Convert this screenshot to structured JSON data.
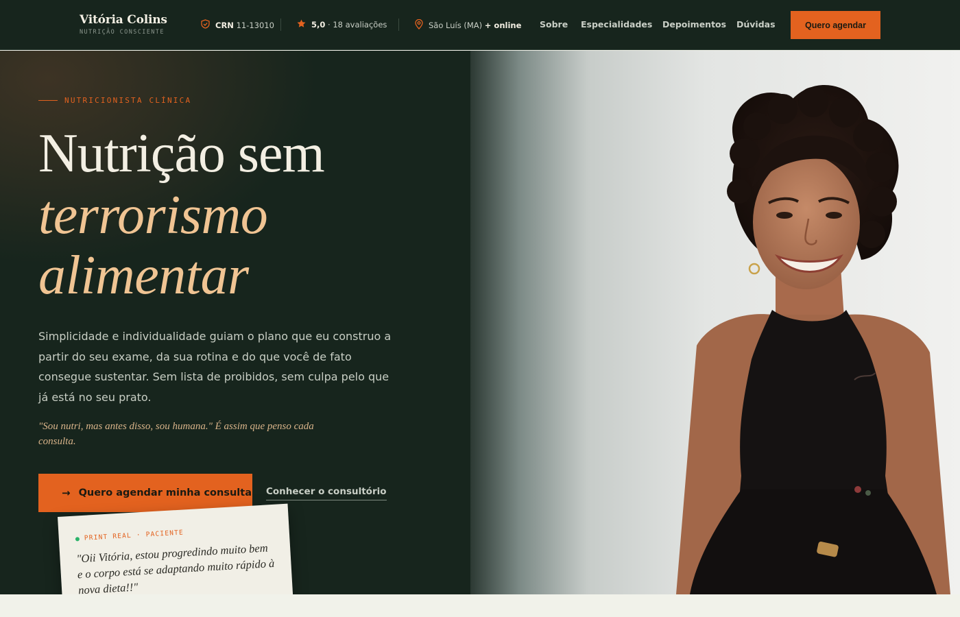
{
  "header": {
    "brand_name": "Vitória Colins",
    "brand_tagline": "NUTRIÇÃO CONSCIENTE",
    "crn_label": "CRN",
    "crn_number": "11-13010",
    "rating_value": "5,0",
    "rating_text": "· 18 avaliações",
    "location": "São Luís (MA)",
    "location_suffix": "+ online",
    "nav": [
      "Sobre",
      "Especialidades",
      "Depoimentos",
      "Dúvidas"
    ],
    "cta_label": "Quero agendar"
  },
  "hero": {
    "eyebrow": "NUTRICIONISTA CLÍNICA",
    "title_line1": "Nutrição sem",
    "title_line2": "terrorismo",
    "title_line3": "alimentar",
    "lead": "Simplicidade e individualidade guiam o plano que eu construo a partir do seu exame, da sua rotina e do que você de fato consegue sustentar. Sem lista de proibidos, sem culpa pelo que já está no seu prato.",
    "quote": "\"Sou nutri, mas antes disso, sou humana.\" É assim que penso cada consulta.",
    "cta_primary": "Quero agendar minha consulta",
    "cta_secondary": "Conhecer o consultório",
    "testimonial": {
      "tag": "PRINT REAL · PACIENTE",
      "text": "\"Oii Vitória, estou progredindo muito bem e o corpo está se adaptando muito rápido à nova dieta!!\""
    }
  },
  "colors": {
    "dark_green": "#17251d",
    "accent_orange": "#e3621f",
    "peach": "#f0c493",
    "cream": "#f3efe3"
  }
}
